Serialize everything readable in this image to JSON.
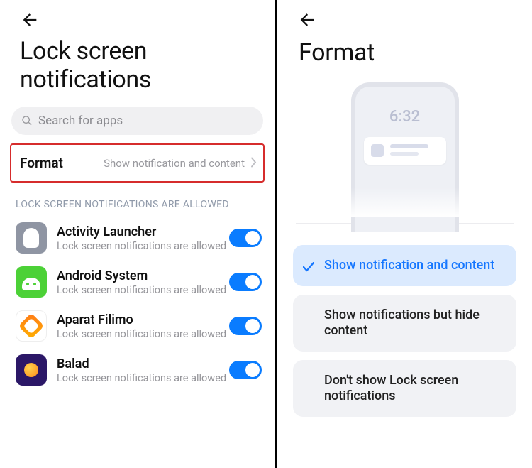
{
  "left": {
    "title": "Lock screen notifications",
    "search_placeholder": "Search for apps",
    "format": {
      "label": "Format",
      "value": "Show notification and content"
    },
    "section_label": "LOCK SCREEN NOTIFICATIONS ARE ALLOWED",
    "app_sub": "Lock screen notifications are allowed",
    "apps": [
      {
        "name": "Activity Launcher",
        "icon": "launcher",
        "on": true
      },
      {
        "name": "Android System",
        "icon": "android",
        "on": true
      },
      {
        "name": "Aparat Filimo",
        "icon": "filimo",
        "on": true
      },
      {
        "name": "Balad",
        "icon": "balad",
        "on": true
      }
    ]
  },
  "right": {
    "title": "Format",
    "preview_time": "6:32",
    "options": [
      {
        "label": "Show notification and content",
        "selected": true
      },
      {
        "label": "Show notifications but hide content",
        "selected": false
      },
      {
        "label": "Don't show Lock screen notifications",
        "selected": false
      }
    ]
  }
}
